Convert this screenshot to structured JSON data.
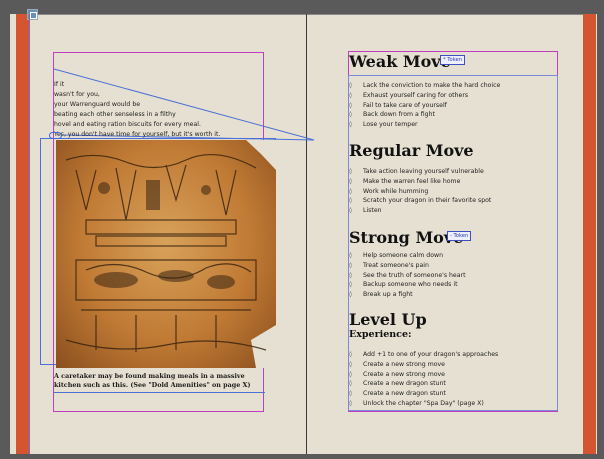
{
  "left_page": {
    "intro_lines": [
      "If it",
      "wasn't for you,",
      "your Warrenguard would be",
      "beating each other senseless in a filthy",
      "hovel and eating ration biscuits for every meal.",
      "Yes, you don't have time for yourself, but it's worth it."
    ],
    "caption_lines": [
      "A caretaker may be found making meals in a massive",
      "kitchen such as this. (See \"Dold Amenities\" on page X)"
    ]
  },
  "right_page": {
    "sections": [
      {
        "title": "Weak Move",
        "tag": "* Token",
        "items": [
          "Lack the conviction to make the hard choice",
          "Exhaust yourself caring for others",
          "Fail to take care of yourself",
          "Back down from a fight",
          "Lose your temper"
        ]
      },
      {
        "title": "Regular Move",
        "tag": "",
        "items": [
          "Take action leaving yourself vulnerable",
          "Make the warren feel like home",
          "Work while humming",
          "Scratch your dragon in their favorite spot",
          "Listen"
        ]
      },
      {
        "title": "Strong Move",
        "tag": "- Token",
        "items": [
          "Help someone calm down",
          "Treat someone's pain",
          "See the truth of someone's heart",
          "Backup someone who needs it",
          "Break up a fight"
        ]
      },
      {
        "title": "Level Up",
        "subtitle": "Experience:",
        "tag": "",
        "items": [
          "Add +1 to one of your dragon's approaches",
          "Create a new strong move",
          "Create a new strong move",
          "Create a new dragon stunt",
          "Create a new dragon stunt",
          "Unlock the chapter \"Spa Day\" (page X)"
        ]
      }
    ]
  },
  "bullet_glyph": "◊",
  "colors": {
    "bleed": "#d4552f",
    "paper": "#e6e0d2",
    "pasteboard": "#5a5a5a",
    "frame_magenta": "#c03fc0",
    "frame_blue": "#4a6fd6"
  },
  "icons": [
    "frame-icon",
    "link-icon"
  ]
}
